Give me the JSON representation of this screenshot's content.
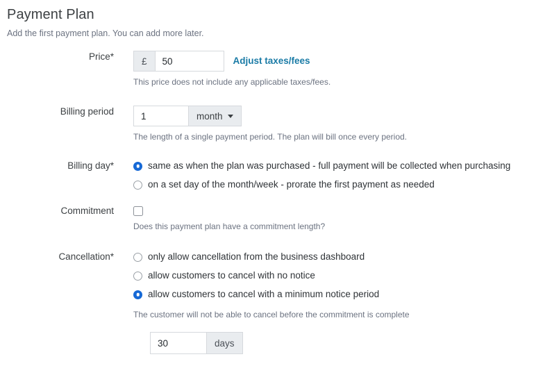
{
  "header": {
    "title": "Payment Plan",
    "subtitle": "Add the first payment plan. You can add more later."
  },
  "form": {
    "price": {
      "label": "Price*",
      "currency_symbol": "£",
      "value": "50",
      "link_label": "Adjust taxes/fees",
      "help": "This price does not include any applicable taxes/fees."
    },
    "billing_period": {
      "label": "Billing period",
      "value": "1",
      "unit": "month",
      "help": "The length of a single payment period. The plan will bill once every period."
    },
    "billing_day": {
      "label": "Billing day*",
      "options": [
        {
          "label": "same as when the plan was purchased - full payment will be collected when purchasing",
          "selected": true
        },
        {
          "label": "on a set day of the month/week - prorate the first payment as needed",
          "selected": false
        }
      ]
    },
    "commitment": {
      "label": "Commitment",
      "checked": false,
      "help": "Does this payment plan have a commitment length?"
    },
    "cancellation": {
      "label": "Cancellation*",
      "options": [
        {
          "label": "only allow cancellation from the business dashboard",
          "selected": false
        },
        {
          "label": "allow customers to cancel with no notice",
          "selected": false
        },
        {
          "label": "allow customers to cancel with a minimum notice period",
          "selected": true
        }
      ],
      "help": "The customer will not be able to cancel before the commitment is complete",
      "notice_value": "30",
      "notice_unit": "days"
    }
  },
  "colors": {
    "accent_link": "#1a7ba6",
    "radio_selected": "#1669d6",
    "addon_bg": "#e9ecef",
    "border": "#d6d9dd",
    "text": "#3c4043",
    "muted_text": "#6b7280"
  }
}
